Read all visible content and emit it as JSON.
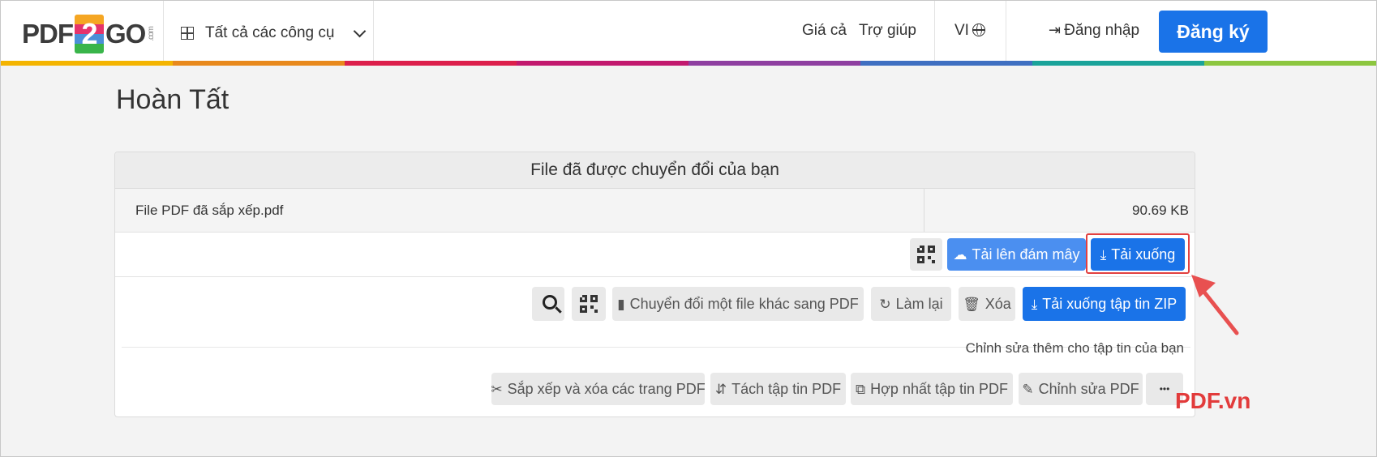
{
  "header": {
    "logo": {
      "pre": "PDF",
      "num": "2",
      "post": "GO",
      "suffix": ".com"
    },
    "tools_label": "Tất cả các công cụ",
    "price_label": "Giá cả",
    "help_label": "Trợ giúp",
    "lang_label": "VI",
    "login_label": "Đăng nhập",
    "signup_label": "Đăng ký",
    "rainbow_colors": [
      "#f4b400",
      "#e8891c",
      "#dc1f4b",
      "#c2196e",
      "#8e3fa0",
      "#3f6fc1",
      "#1aa39a",
      "#8cc63f"
    ]
  },
  "main": {
    "title": "Hoàn Tất",
    "card_title": "File đã được chuyển đổi của bạn",
    "file_name": "File PDF đã sắp xếp.pdf",
    "file_size": "90.69 KB",
    "upload_cloud_label": "Tải lên đám mây",
    "download_label": "Tải xuống",
    "convert_other_label": "Chuyển đổi một file khác sang PDF",
    "redo_label": "Làm lại",
    "delete_label": "Xóa",
    "download_zip_label": "Tải xuống tập tin ZIP",
    "edit_more_label": "Chỉnh sửa thêm cho tập tin của bạn",
    "tools": [
      {
        "label": "Sắp xếp và xóa các trang PDF",
        "icon": "scissors-icon"
      },
      {
        "label": "Tách tập tin PDF",
        "icon": "split-icon"
      },
      {
        "label": "Hợp nhất tập tin PDF",
        "icon": "copy-icon"
      },
      {
        "label": "Chỉnh sửa PDF",
        "icon": "edit-icon"
      }
    ],
    "more_label": "•••"
  },
  "watermark": "PDF.vn"
}
